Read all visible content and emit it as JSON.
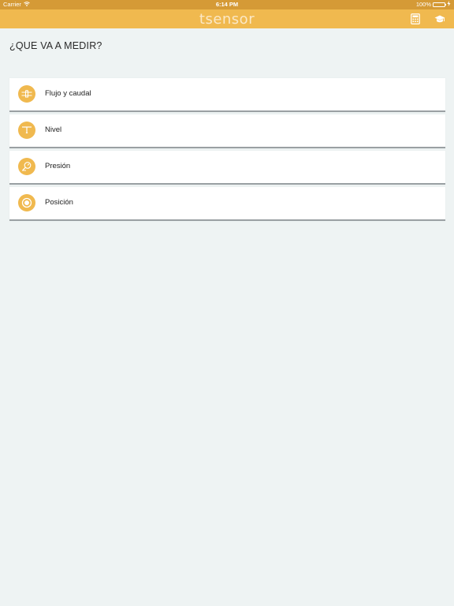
{
  "status_bar": {
    "carrier": "Carrier",
    "time": "6:14 PM",
    "battery": "100%",
    "battery_level": 1.0
  },
  "nav": {
    "logo": "tsensor",
    "icons": [
      "calculator-icon",
      "graduation-cap-icon"
    ]
  },
  "question": "¿QUE VA A MEDIR?",
  "options": [
    {
      "label": "Flujo y caudal",
      "icon": "flow-icon"
    },
    {
      "label": "Nivel",
      "icon": "level-icon"
    },
    {
      "label": "Presión",
      "icon": "pressure-icon"
    },
    {
      "label": "Posición",
      "icon": "position-icon"
    }
  ],
  "colors": {
    "status_bar": "#d59a36",
    "nav_bar": "#f0b94f",
    "accent": "#f0b94f",
    "background": "#eef3f3"
  }
}
